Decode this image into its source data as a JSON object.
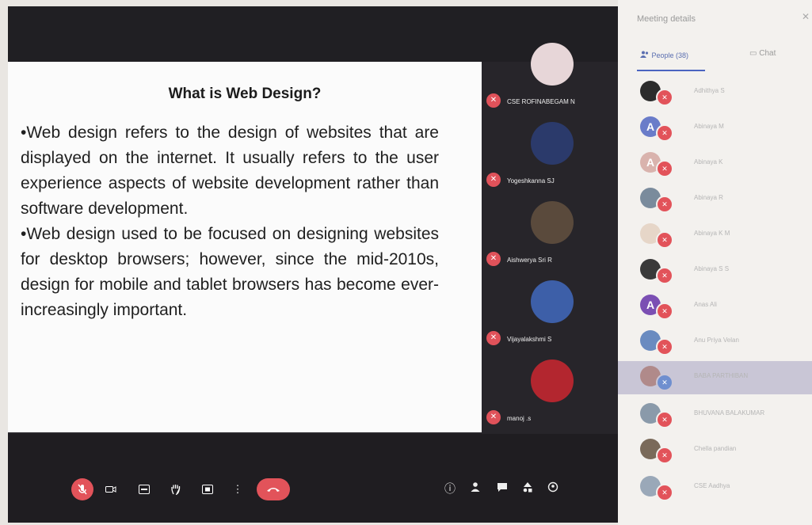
{
  "slide": {
    "title": "What is Web Design?",
    "paragraphs": [
      "•Web design refers to the design of websites that are displayed on the internet. It usually refers to the user experience aspects of website development rather than software development.",
      "•Web design used to be focused on designing websites for desktop browsers; however, since the mid-2010s, design for mobile and tablet browsers has become ever-increasingly important."
    ]
  },
  "tiles": [
    {
      "name": "CSE ROFINABEGAM N",
      "avatar_color": "#e7d6d8"
    },
    {
      "name": "Yogeshkanna SJ",
      "avatar_color": "#2b3a6b"
    },
    {
      "name": "Aishwerya Sri R",
      "avatar_color": "#5a4a3c"
    },
    {
      "name": "Vijayalakshmi S",
      "avatar_color": "#3d5fa8"
    },
    {
      "name": "manoj .s",
      "avatar_color": "#b3262f"
    }
  ],
  "panel": {
    "title": "Meeting details",
    "close_icon": "close-icon",
    "tabs": {
      "people": "People (38)",
      "chat": "Chat"
    },
    "people": [
      {
        "initial": "",
        "avatar_color": "#2c2c2c",
        "name": "Adhithya S"
      },
      {
        "initial": "A",
        "avatar_color": "#6a7cc9",
        "name": "Abinaya M"
      },
      {
        "initial": "A",
        "avatar_color": "#d9b3ad",
        "name": "Abinaya K"
      },
      {
        "initial": "",
        "avatar_color": "#7a8b9c",
        "name": "Abinaya R"
      },
      {
        "initial": "",
        "avatar_color": "#e6d6c8",
        "name": "Abinaya K M"
      },
      {
        "initial": "",
        "avatar_color": "#3a3a3a",
        "name": "Abinaya S S"
      },
      {
        "initial": "A",
        "avatar_color": "#7b4fb3",
        "name": "Anas Ali"
      },
      {
        "initial": "",
        "avatar_color": "#6a8bc0",
        "name": "Anu Priya Velan"
      },
      {
        "initial": "",
        "avatar_color": "#b08a8a",
        "name": "BABA PARTHIBAN",
        "highlight": true
      },
      {
        "initial": "",
        "avatar_color": "#8a9aaa",
        "name": "BHUVANA BALAKUMAR"
      },
      {
        "initial": "",
        "avatar_color": "#7a6a5a",
        "name": "Chella pandian"
      },
      {
        "initial": "",
        "avatar_color": "#9aa8b8",
        "name": "CSE Aadhya"
      }
    ]
  },
  "controls": {
    "left_icons": [
      "mic-off-icon",
      "camera-icon",
      "captions-icon",
      "raise-hand-icon",
      "present-icon",
      "more-icon",
      "end-call-icon"
    ],
    "right_icons": [
      "info-icon",
      "people-icon",
      "chat-icon",
      "activities-icon",
      "security-icon"
    ]
  },
  "colors": {
    "accent_red": "#e2535a",
    "panel_blue": "#4a64c0"
  }
}
